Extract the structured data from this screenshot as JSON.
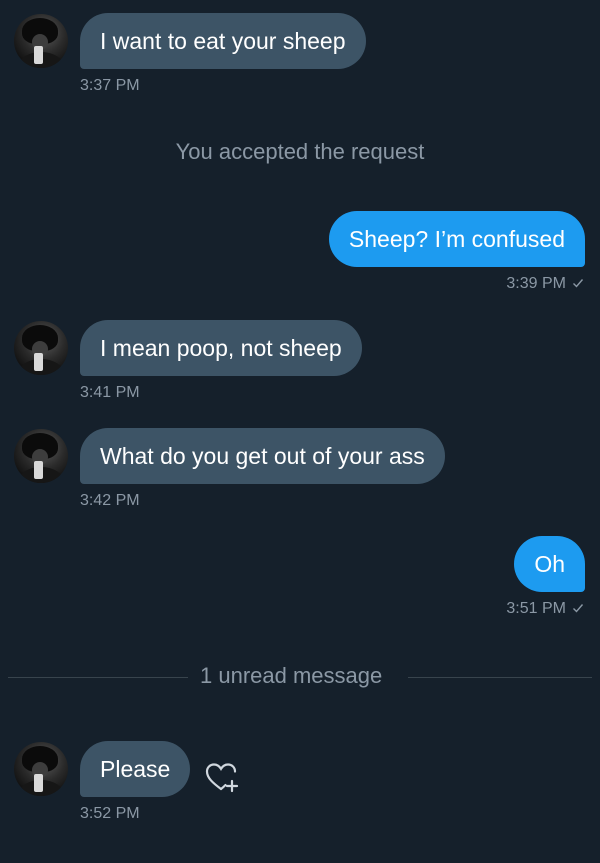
{
  "conversation": {
    "messages": [
      {
        "direction": "in",
        "text": "I want to eat your sheep",
        "time": "3:37 PM"
      },
      {
        "direction": "system",
        "text": "You accepted the request"
      },
      {
        "direction": "out",
        "text": "Sheep? I’m confused",
        "time": "3:39 PM"
      },
      {
        "direction": "in",
        "text": "I mean poop, not sheep",
        "time": "3:41 PM"
      },
      {
        "direction": "in",
        "text": "What do you get out of your ass",
        "time": "3:42 PM"
      },
      {
        "direction": "out",
        "text": "Oh",
        "time": "3:51 PM"
      },
      {
        "direction": "in",
        "text": "Please",
        "time": "3:52 PM"
      }
    ],
    "unread_divider": "1 unread message"
  },
  "colors": {
    "background": "#15202b",
    "incoming_bubble": "#3d5466",
    "outgoing_bubble": "#1d9bf0",
    "muted_text": "#8b98a5"
  },
  "icons": {
    "read_receipt": "check-icon",
    "react": "heart-plus-icon"
  }
}
